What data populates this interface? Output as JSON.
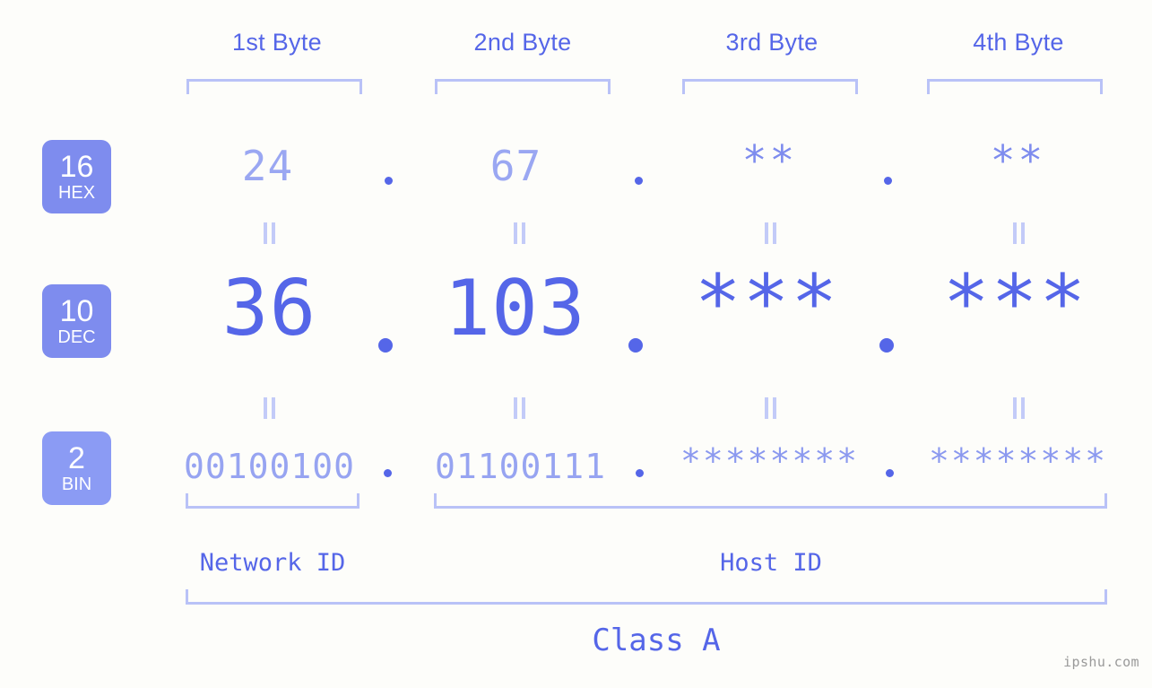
{
  "watermark": "ipshu.com",
  "columns": [
    {
      "header": "1st Byte"
    },
    {
      "header": "2nd Byte"
    },
    {
      "header": "3rd Byte"
    },
    {
      "header": "4th Byte"
    }
  ],
  "rows": {
    "hex": {
      "badge_number": "16",
      "badge_name": "HEX",
      "badge_color": "#7e8cee",
      "values": [
        "24",
        "67",
        "**",
        "**"
      ]
    },
    "dec": {
      "badge_number": "10",
      "badge_name": "DEC",
      "badge_color": "#7e8cee",
      "values": [
        "36",
        "103",
        "***",
        "***"
      ]
    },
    "bin": {
      "badge_number": "2",
      "badge_name": "BIN",
      "badge_color": "#8b9bf4",
      "values": [
        "00100100",
        "01100111",
        "********",
        "********"
      ]
    }
  },
  "separators": {
    "dot": ".",
    "equals": "="
  },
  "footer": {
    "network_id": "Network ID",
    "host_id": "Host ID",
    "class": "Class A"
  },
  "colors": {
    "background": "#fdfdfa",
    "accent": "#5566e8",
    "accent_light": "#9aa7f2",
    "bracket": "#b9c2f7",
    "equals": "#c3cbf8",
    "watermark_text": "#9a9a9a"
  }
}
